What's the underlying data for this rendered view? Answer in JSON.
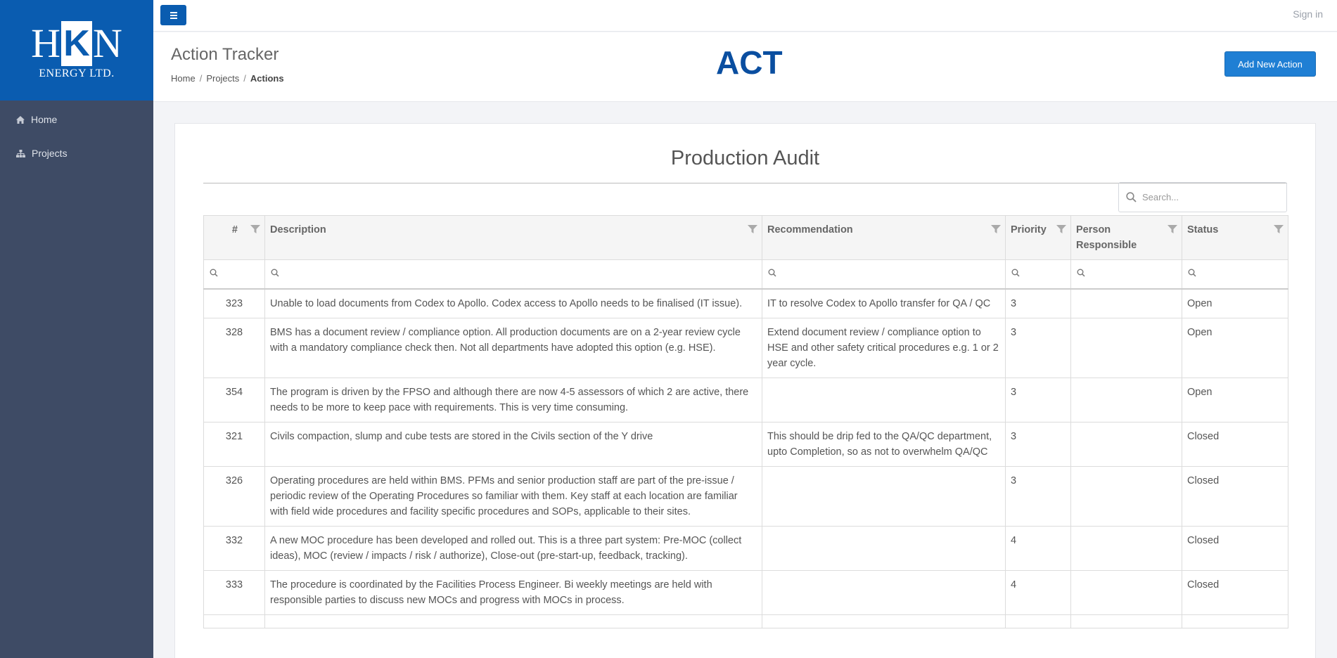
{
  "sidebar": {
    "logo": {
      "letters": [
        "H",
        "K",
        "N"
      ],
      "subtitle": "ENERGY LTD."
    },
    "items": [
      {
        "label": "Home",
        "icon": "home-icon"
      },
      {
        "label": "Projects",
        "icon": "sitemap-icon"
      }
    ]
  },
  "topbar": {
    "menu_icon": "hamburger-icon",
    "signin_label": "Sign in"
  },
  "header": {
    "title": "Action Tracker",
    "breadcrumb": [
      "Home",
      "Projects",
      "Actions"
    ],
    "brand": "ACT",
    "add_button_label": "Add New Action"
  },
  "card": {
    "title": "Production Audit",
    "search": {
      "placeholder": "Search...",
      "value": ""
    }
  },
  "table": {
    "columns": [
      "#",
      "Description",
      "Recommendation",
      "Priority",
      "Person Responsible",
      "Status"
    ],
    "rows": [
      {
        "id": "323",
        "description": "Unable to load documents from Codex to Apollo. Codex access to Apollo needs to be finalised (IT issue).",
        "recommendation": "IT to resolve Codex to Apollo transfer for QA / QC",
        "priority": "3",
        "person": "",
        "status": "Open"
      },
      {
        "id": "328",
        "description": "BMS has a document review / compliance option. All production documents are on a 2-year review cycle with a mandatory compliance check then. Not all departments have adopted this option (e.g. HSE).",
        "recommendation": "Extend document review / compliance option to HSE and other safety critical procedures e.g. 1 or 2 year cycle.",
        "priority": "3",
        "person": "",
        "status": "Open"
      },
      {
        "id": "354",
        "description": "The program is driven by the FPSO and although there are now 4-5 assessors of which 2 are active, there needs to be more to keep pace with requirements. This is very time consuming.",
        "recommendation": "",
        "priority": "3",
        "person": "",
        "status": "Open"
      },
      {
        "id": "321",
        "description": "Civils compaction, slump and cube tests are stored in the Civils section of the Y drive",
        "recommendation": "This should be drip fed to the QA/QC department, upto Completion, so as not to overwhelm QA/QC",
        "priority": "3",
        "person": "",
        "status": "Closed"
      },
      {
        "id": "326",
        "description": "Operating procedures are held within BMS. PFMs and senior production staff are part of the pre-issue / periodic review of the Operating Procedures so familiar with them. Key staff at each location are familiar with field wide procedures and facility specific procedures and SOPs, applicable to their sites.",
        "recommendation": "",
        "priority": "3",
        "person": "",
        "status": "Closed"
      },
      {
        "id": "332",
        "description": "A new MOC procedure has been developed and rolled out. This is a three part system: Pre-MOC (collect ideas), MOC (review / impacts / risk / authorize), Close-out (pre-start-up, feedback, tracking).",
        "recommendation": "",
        "priority": "4",
        "person": "",
        "status": "Closed"
      },
      {
        "id": "333",
        "description": "The procedure is coordinated by the Facilities Process Engineer. Bi weekly meetings are held with responsible parties to discuss new MOCs and progress with MOCs in process.",
        "recommendation": "",
        "priority": "4",
        "person": "",
        "status": "Closed"
      }
    ]
  },
  "colors": {
    "brand_blue": "#0a5cb0",
    "sidebar_bg": "#3e4b65",
    "button_blue": "#1f7fd4"
  }
}
